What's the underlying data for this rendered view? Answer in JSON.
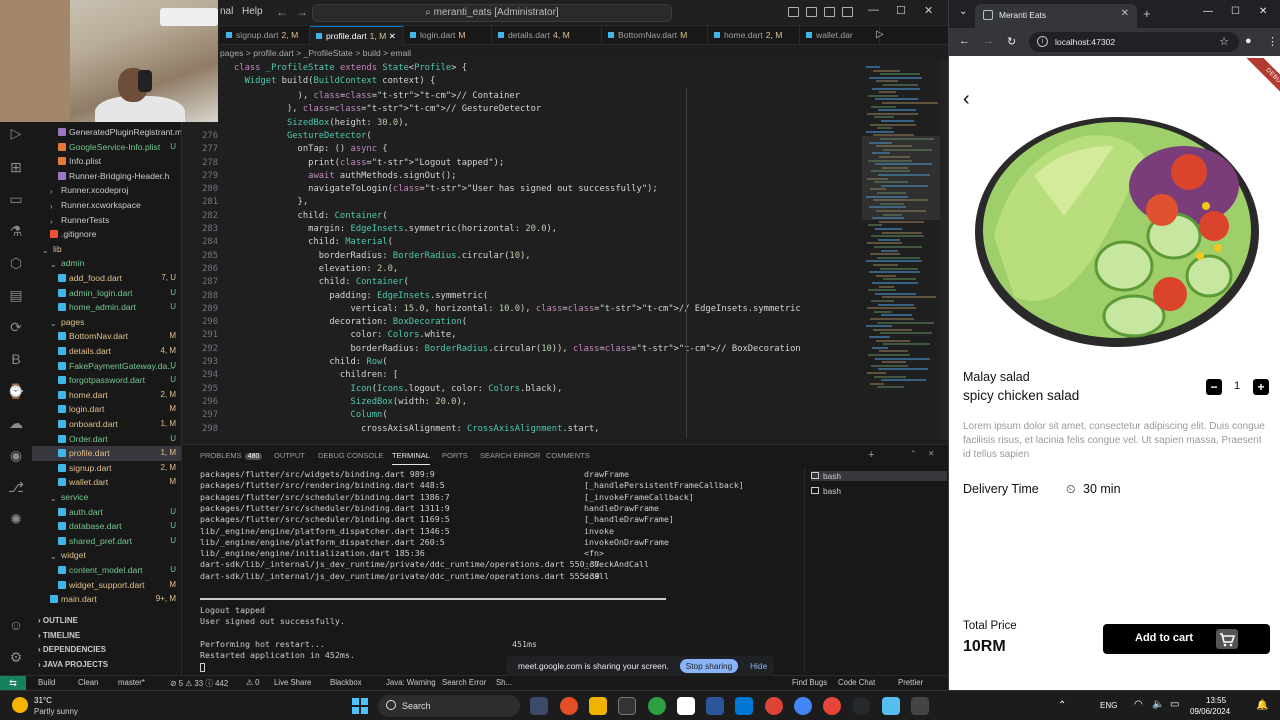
{
  "vscode": {
    "menu": [
      "nal",
      "Help"
    ],
    "command_center": "meranti_eats [Administrator]",
    "tabs": [
      {
        "label": "signup.dart",
        "mod": "2, M"
      },
      {
        "label": "profile.dart",
        "mod": "1, M"
      },
      {
        "label": "login.dart",
        "mod": "M"
      },
      {
        "label": "details.dart",
        "mod": "4, M"
      },
      {
        "label": "BottomNav.dart",
        "mod": "M"
      },
      {
        "label": "home.dart",
        "mod": "2, M"
      },
      {
        "label": "wallet.dar",
        "mod": ""
      }
    ],
    "breadcrumb": "pages > profile.dart > _ProfileState > build > email",
    "explorer": [
      {
        "name": "GeneratedPluginRegistrant.m",
        "badge": "",
        "indent": 2,
        "color": "#cccccc",
        "icon": "c"
      },
      {
        "name": "GoogleService-Info.plist",
        "badge": "U",
        "indent": 2,
        "color": "#73c991",
        "icon": "plist"
      },
      {
        "name": "Info.plist",
        "badge": "",
        "indent": 2,
        "color": "#cccccc",
        "icon": "plist"
      },
      {
        "name": "Runner-Bridging-Header.h",
        "badge": "",
        "indent": 2,
        "color": "#cccccc",
        "icon": "c"
      },
      {
        "name": "Runner.xcodeproj",
        "badge": "",
        "indent": 1,
        "color": "#cccccc",
        "icon": "folder"
      },
      {
        "name": "Runner.xcworkspace",
        "badge": "",
        "indent": 1,
        "color": "#cccccc",
        "icon": "folder"
      },
      {
        "name": "RunnerTests",
        "badge": "",
        "indent": 1,
        "color": "#cccccc",
        "icon": "folder"
      },
      {
        "name": ".gitignore",
        "badge": "",
        "indent": 1,
        "color": "#cccccc",
        "icon": "git"
      },
      {
        "name": "lib",
        "badge": "",
        "indent": 0,
        "color": "#e2c08d",
        "icon": "folder-open"
      },
      {
        "name": "admin",
        "badge": "",
        "indent": 1,
        "color": "#73c991",
        "icon": "folder-open"
      },
      {
        "name": "add_food.dart",
        "badge": "7, U",
        "indent": 2,
        "color": "#e2c08d",
        "icon": "dart"
      },
      {
        "name": "admin_login.dart",
        "badge": "U",
        "indent": 2,
        "color": "#73c991",
        "icon": "dart"
      },
      {
        "name": "home_admin.dart",
        "badge": "U",
        "indent": 2,
        "color": "#73c991",
        "icon": "dart"
      },
      {
        "name": "pages",
        "badge": "",
        "indent": 1,
        "color": "#e2c08d",
        "icon": "folder-open"
      },
      {
        "name": "BottomNav.dart",
        "badge": "M",
        "indent": 2,
        "color": "#e2c08d",
        "icon": "dart"
      },
      {
        "name": "details.dart",
        "badge": "4, M",
        "indent": 2,
        "color": "#e2c08d",
        "icon": "dart"
      },
      {
        "name": "FakePaymentGateway.da...",
        "badge": "U",
        "indent": 2,
        "color": "#73c991",
        "icon": "dart"
      },
      {
        "name": "forgotpassword.dart",
        "badge": "U",
        "indent": 2,
        "color": "#73c991",
        "icon": "dart"
      },
      {
        "name": "home.dart",
        "badge": "2, M",
        "indent": 2,
        "color": "#e2c08d",
        "icon": "dart"
      },
      {
        "name": "login.dart",
        "badge": "M",
        "indent": 2,
        "color": "#e2c08d",
        "icon": "dart"
      },
      {
        "name": "onboard.dart",
        "badge": "1, M",
        "indent": 2,
        "color": "#e2c08d",
        "icon": "dart"
      },
      {
        "name": "Order.dart",
        "badge": "U",
        "indent": 2,
        "color": "#73c991",
        "icon": "dart"
      },
      {
        "name": "profile.dart",
        "badge": "1, M",
        "indent": 2,
        "color": "#e2c08d",
        "icon": "dart",
        "selected": true
      },
      {
        "name": "signup.dart",
        "badge": "2, M",
        "indent": 2,
        "color": "#e2c08d",
        "icon": "dart"
      },
      {
        "name": "wallet.dart",
        "badge": "M",
        "indent": 2,
        "color": "#e2c08d",
        "icon": "dart"
      },
      {
        "name": "service",
        "badge": "",
        "indent": 1,
        "color": "#73c991",
        "icon": "folder-open"
      },
      {
        "name": "auth.dart",
        "badge": "U",
        "indent": 2,
        "color": "#73c991",
        "icon": "dart"
      },
      {
        "name": "database.dart",
        "badge": "U",
        "indent": 2,
        "color": "#73c991",
        "icon": "dart"
      },
      {
        "name": "shared_pref.dart",
        "badge": "U",
        "indent": 2,
        "color": "#73c991",
        "icon": "dart"
      },
      {
        "name": "widget",
        "badge": "",
        "indent": 1,
        "color": "#e2c08d",
        "icon": "folder-open"
      },
      {
        "name": "content_model.dart",
        "badge": "U",
        "indent": 2,
        "color": "#73c991",
        "icon": "dart"
      },
      {
        "name": "widget_support.dart",
        "badge": "M",
        "indent": 2,
        "color": "#e2c08d",
        "icon": "dart"
      },
      {
        "name": "main.dart",
        "badge": "9+, M",
        "indent": 1,
        "color": "#e2c08d",
        "icon": "dart"
      }
    ],
    "sections": [
      "OUTLINE",
      "TIMELINE",
      "DEPENDENCIES",
      "JAVA PROJECTS"
    ],
    "sticky_lines": [
      "class _ProfileState extends State<Profile> {",
      "  Widget build(BuildContext context) {"
    ],
    "code": [
      {
        "n": "",
        "t": "            ), // Container"
      },
      {
        "n": "",
        "t": "          ), // GestureDetector"
      },
      {
        "n": "",
        "t": "          SizedBox(height: 30.0),"
      },
      {
        "n": "276",
        "t": "          GestureDetector("
      },
      {
        "n": "277",
        "t": "            onTap: () async {"
      },
      {
        "n": "278",
        "t": "              print(\"Logout tapped\");"
      },
      {
        "n": "279",
        "t": "              await authMethods.signOut();"
      },
      {
        "n": "280",
        "t": "              navigateToLogin(\"User has signed out successfully\");"
      },
      {
        "n": "281",
        "t": "            },"
      },
      {
        "n": "282",
        "t": "            child: Container("
      },
      {
        "n": "283",
        "t": "              margin: EdgeInsets.symmetric(horizontal: 20.0),"
      },
      {
        "n": "284",
        "t": "              child: Material("
      },
      {
        "n": "285",
        "t": "                borderRadius: BorderRadius.circular(10),"
      },
      {
        "n": "286",
        "t": "                elevation: 2.0,"
      },
      {
        "n": "287",
        "t": "                child: Container("
      },
      {
        "n": "288",
        "t": "                  padding: EdgeInsets.symmetric("
      },
      {
        "n": "289",
        "t": "                      vertical: 15.0, horizontal: 10.0), // EdgeInsets.symmetric"
      },
      {
        "n": "290",
        "t": "                  decoration: BoxDecoration("
      },
      {
        "n": "291",
        "t": "                      color: Colors.white,"
      },
      {
        "n": "292",
        "t": "                      borderRadius: BorderRadius.circular(10)), // BoxDecoration"
      },
      {
        "n": "293",
        "t": "                  child: Row("
      },
      {
        "n": "294",
        "t": "                    children: ["
      },
      {
        "n": "295",
        "t": "                      Icon(Icons.logout, color: Colors.black),"
      },
      {
        "n": "296",
        "t": "                      SizedBox(width: 20.0),"
      },
      {
        "n": "297",
        "t": "                      Column("
      },
      {
        "n": "298",
        "t": "                        crossAxisAlignment: CrossAxisAlignment.start,"
      }
    ],
    "panel_tabs": [
      {
        "label": "PROBLEMS",
        "badge": "480"
      },
      {
        "label": "OUTPUT",
        "badge": ""
      },
      {
        "label": "DEBUG CONSOLE",
        "badge": ""
      },
      {
        "label": "TERMINAL",
        "badge": ""
      },
      {
        "label": "PORTS",
        "badge": ""
      },
      {
        "label": "SEARCH ERROR",
        "badge": ""
      },
      {
        "label": "COMMENTS",
        "badge": ""
      }
    ],
    "terminal_left": [
      "packages/flutter/src/widgets/binding.dart 989:9",
      "packages/flutter/src/rendering/binding.dart 448:5",
      "packages/flutter/src/scheduler/binding.dart 1386:7",
      "packages/flutter/src/scheduler/binding.dart 1311:9",
      "packages/flutter/src/scheduler/binding.dart 1169:5",
      "lib/_engine/engine/platform_dispatcher.dart 1346:5",
      "lib/_engine/engine/platform_dispatcher.dart 260:5",
      "lib/_engine/engine/initialization.dart 185:36",
      "dart-sdk/lib/_internal/js_dev_runtime/private/ddc_runtime/operations.dart 550:37",
      "dart-sdk/lib/_internal/js_dev_runtime/private/ddc_runtime/operations.dart 555:39"
    ],
    "terminal_right": [
      "drawFrame",
      "[_handlePersistentFrameCallback]",
      "[_invokeFrameCallback]",
      "handleDrawFrame",
      "[_handleDrawFrame]",
      "invoke",
      "invokeOnDrawFrame",
      "<fn>",
      "_checkAndCall",
      "dcall"
    ],
    "terminal_tail": [
      "Logout tapped",
      "User signed out successfully.",
      "",
      "Performing hot restart...",
      "Restarted application in 452ms."
    ],
    "terminal_timing": "451ms",
    "terminals": [
      "bash",
      "bash"
    ],
    "share_bar": {
      "message": "meet.google.com is sharing your screen.",
      "stop": "Stop sharing",
      "hide": "Hide"
    },
    "status": [
      "Build",
      "Clean",
      "master*",
      "⊘ 5 ⚠ 33 ⓘ 442",
      "⚠ 0",
      "Live Share",
      "Blackbox",
      "Java: Warning",
      "Search Error",
      "Sh...",
      "Find Bugs",
      "Code Chat",
      "Prettier"
    ]
  },
  "chrome": {
    "tab_title": "Meranti Eats",
    "url": "localhost:47302",
    "debug_label": "DEBUG",
    "app": {
      "title_line1": "Malay salad",
      "title_line2": "spicy chicken salad",
      "quantity": "1",
      "description": "Lorem ipsum dolor sit amet, consectetur adipiscing elit. Duis congue facilisis risus, et lacinia felis congue vel. Ut sapien massa, Praesent id tellus sapien",
      "delivery_label": "Delivery Time",
      "delivery_value": "30 min",
      "total_label": "Total Price",
      "total_value": "10RM",
      "add_to_cart": "Add to cart"
    }
  },
  "taskbar": {
    "temperature": "31°C",
    "weather": "Partly sunny",
    "search": "Search",
    "lang": "ENG",
    "time": "13:55",
    "date": "09/06/2024"
  }
}
